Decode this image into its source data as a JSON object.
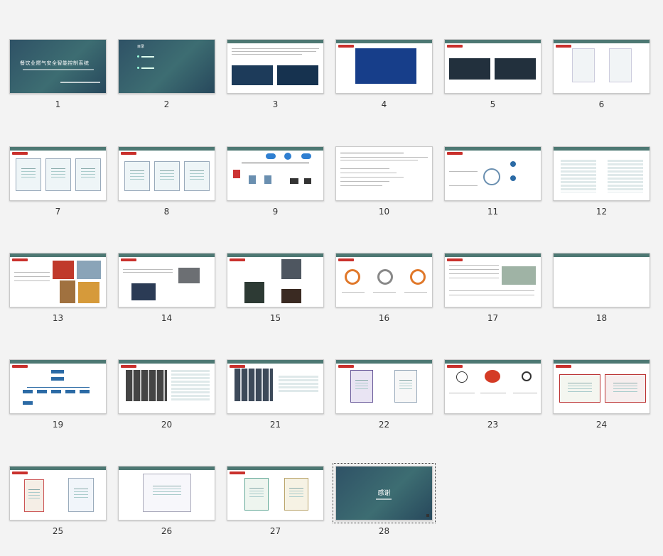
{
  "slides": [
    {
      "number": "1",
      "title": "餐饮业燃气安全智能控制系统"
    },
    {
      "number": "2",
      "title": "目录"
    },
    {
      "number": "3"
    },
    {
      "number": "4"
    },
    {
      "number": "5"
    },
    {
      "number": "6"
    },
    {
      "number": "7"
    },
    {
      "number": "8"
    },
    {
      "number": "9"
    },
    {
      "number": "10"
    },
    {
      "number": "11"
    },
    {
      "number": "12"
    },
    {
      "number": "13"
    },
    {
      "number": "14"
    },
    {
      "number": "15"
    },
    {
      "number": "16"
    },
    {
      "number": "17"
    },
    {
      "number": "18"
    },
    {
      "number": "19"
    },
    {
      "number": "20"
    },
    {
      "number": "21"
    },
    {
      "number": "22"
    },
    {
      "number": "23"
    },
    {
      "number": "24"
    },
    {
      "number": "25"
    },
    {
      "number": "26"
    },
    {
      "number": "27"
    },
    {
      "number": "28",
      "title": "感谢",
      "selected": true
    }
  ],
  "colors": {
    "header_bar": "#4d7873",
    "tag_red": "#c9302c",
    "dark_slide": "#2f5266",
    "ring_orange": "#e0782a",
    "ring_gray": "#888888"
  }
}
